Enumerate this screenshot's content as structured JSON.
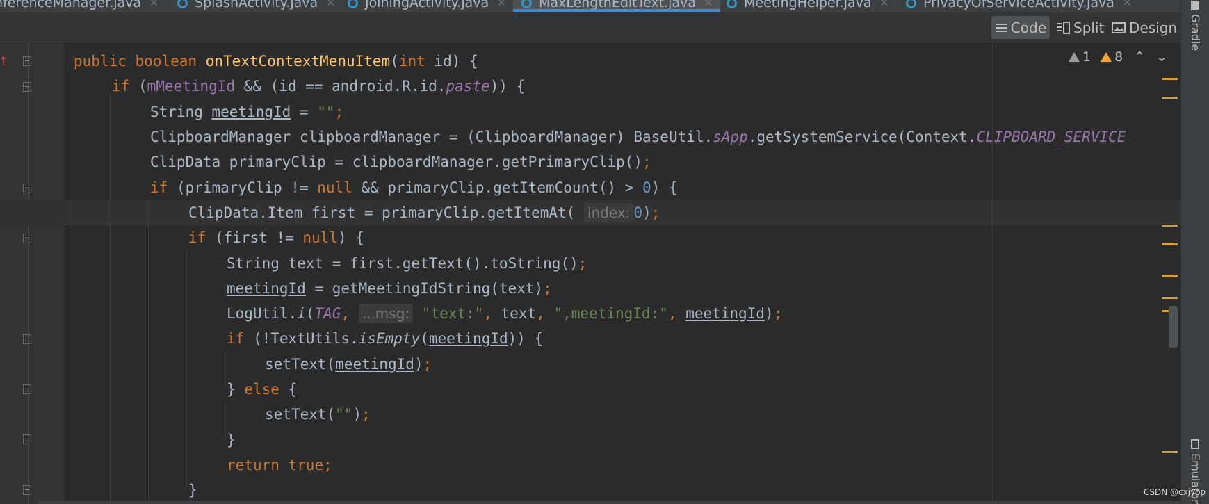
{
  "tabs": [
    {
      "label": "nferenceManager.java",
      "active": false
    },
    {
      "label": "SplashActivity.java",
      "active": false
    },
    {
      "label": "JoiningActivity.java",
      "active": false
    },
    {
      "label": "MaxLengthEditText.java",
      "active": true
    },
    {
      "label": "MeetingHelper.java",
      "active": false
    },
    {
      "label": "PrivacyOfServiceActivity.java",
      "active": false
    }
  ],
  "view_modes": {
    "code": "Code",
    "split": "Split",
    "design": "Design",
    "selected": "Code"
  },
  "inspections": {
    "weak_warnings": "1",
    "warnings": "8"
  },
  "side_panels": {
    "gradle": "Gradle",
    "emulator": "Emulator"
  },
  "watermark": "CSDN @cxjyop",
  "code": {
    "l1": {
      "kw1": "public",
      "kw2": "boolean",
      "fn": "onTextContextMenuItem",
      "p1": "(",
      "kw3": "int",
      "p2": " id) {"
    },
    "l2": {
      "kw": "if",
      "p1": " (",
      "fld": "mMeetingId",
      "p2": " && (id == android.R.id.",
      "sfld": "paste",
      "p3": ")) {"
    },
    "l3": {
      "p1": "String ",
      "var": "meetingId",
      "p2": " = ",
      "str": "\"\"",
      "semi": ";"
    },
    "l4": {
      "p1": "ClipboardManager clipboardManager = (ClipboardManager) BaseUtil.",
      "sfld": "sApp",
      "p2": ".getSystemService(Context.",
      "sfld2": "CLIPBOARD_SERVICE"
    },
    "l5": {
      "p1": "ClipData primaryClip = clipboardManager.getPrimaryClip()",
      "semi": ";"
    },
    "l6": {
      "kw": "if",
      "p1": " (primaryClip != ",
      "kw2": "null",
      "p2": " && primaryClip.getItemCount() > ",
      "num": "0",
      "p3": ") {"
    },
    "l7": {
      "p1": "ClipData.Item first = primaryClip.getItemAt(",
      "hint": "index:",
      "num": "0",
      "p2": ")",
      "semi": ";"
    },
    "l8": {
      "kw": "if",
      "p1": " (first != ",
      "kw2": "null",
      "p2": ") {"
    },
    "l9": {
      "p1": "String text = first.getText().toString()",
      "semi": ";"
    },
    "l10": {
      "var": "meetingId",
      "p1": " = getMeetingIdString(text)",
      "semi": ";"
    },
    "l11": {
      "p1": "LogUtil.",
      "m": "i",
      "p2": "(",
      "sfld": "TAG",
      "c1": ",",
      "hint": "...msg:",
      "str1": "\"text:\"",
      "c2": ",",
      "p3": " text",
      "c3": ",",
      "str2": "\",meetingId:\"",
      "c4": ",",
      "var": "meetingId",
      "p4": ")",
      "semi": ";"
    },
    "l12": {
      "kw": "if",
      "p1": " (!TextUtils.",
      "m": "isEmpty",
      "p2": "(",
      "var": "meetingId",
      "p3": ")) {"
    },
    "l13": {
      "p1": "setText(",
      "var": "meetingId",
      "p2": ")",
      "semi": ";"
    },
    "l14": {
      "p1": "} ",
      "kw": "else",
      "p2": " {"
    },
    "l15": {
      "p1": "setText(",
      "str": "\"\"",
      "p2": ")",
      "semi": ";"
    },
    "l16": {
      "p1": "}"
    },
    "l17": {
      "kw": "return",
      "kw2": "true",
      "semi": ";"
    },
    "l18": {
      "p1": "}"
    }
  }
}
